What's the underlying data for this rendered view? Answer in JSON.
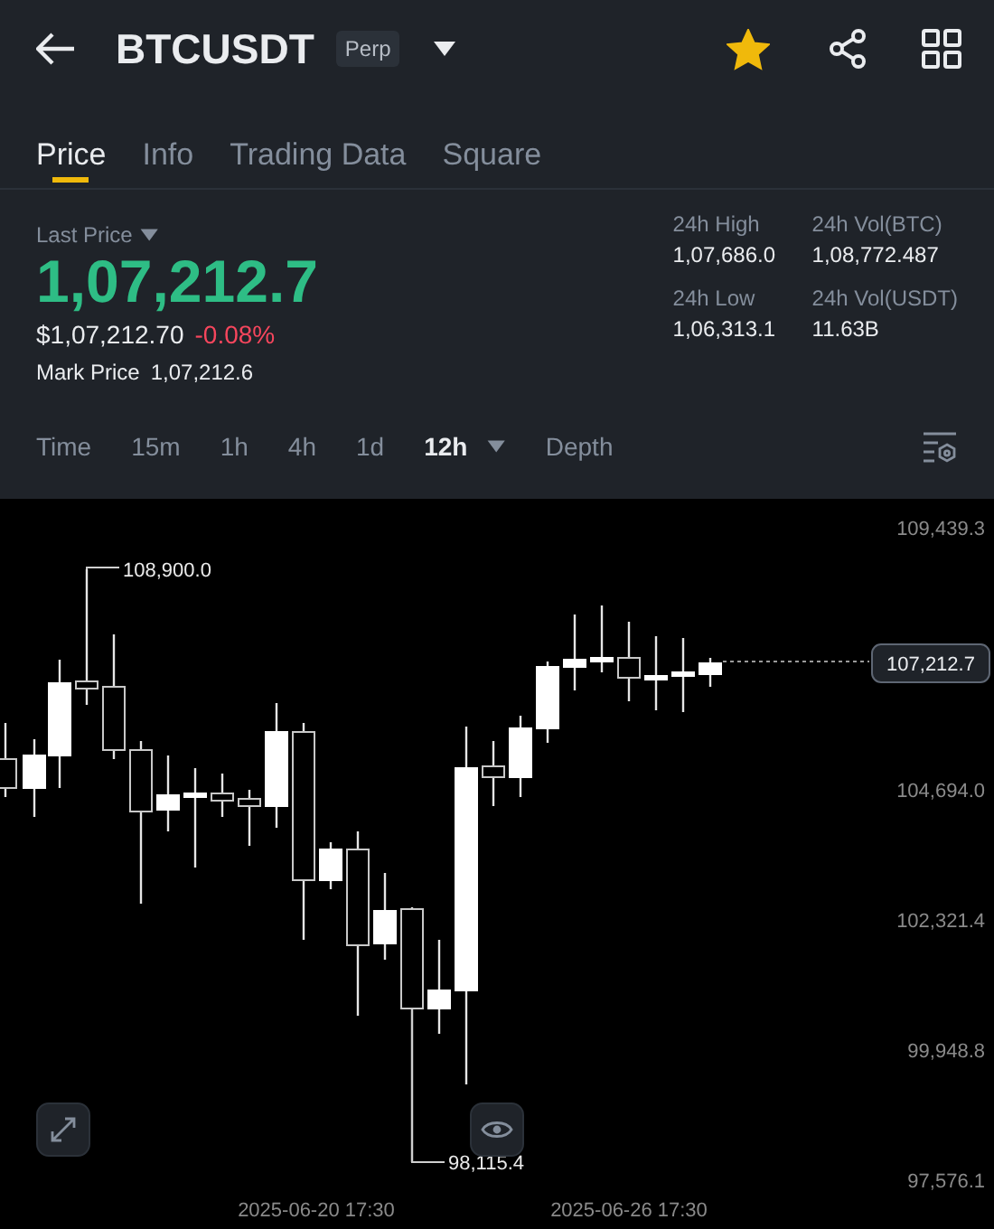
{
  "header": {
    "symbol": "BTCUSDT",
    "badge": "Perp",
    "favorite": true
  },
  "tabs": [
    {
      "label": "Price",
      "selected": true
    },
    {
      "label": "Info",
      "selected": false
    },
    {
      "label": "Trading Data",
      "selected": false
    },
    {
      "label": "Square",
      "selected": false
    }
  ],
  "price": {
    "label": "Last Price",
    "last": "1,07,212.7",
    "usd": "$1,07,212.70",
    "change": "-0.08%",
    "mark_label": "Mark Price",
    "mark": "1,07,212.6"
  },
  "stats": [
    {
      "label": "24h High",
      "value": "1,07,686.0"
    },
    {
      "label": "24h Vol(BTC)",
      "value": "1,08,772.487"
    },
    {
      "label": "24h Low",
      "value": "1,06,313.1"
    },
    {
      "label": "24h Vol(USDT)",
      "value": "11.63B"
    }
  ],
  "intervals": [
    {
      "label": "Time",
      "selected": false,
      "menu": false
    },
    {
      "label": "15m",
      "selected": false,
      "menu": false
    },
    {
      "label": "1h",
      "selected": false,
      "menu": false
    },
    {
      "label": "4h",
      "selected": false,
      "menu": false
    },
    {
      "label": "1d",
      "selected": false,
      "menu": false
    },
    {
      "label": "12h",
      "selected": true,
      "menu": true
    },
    {
      "label": "Depth",
      "selected": false,
      "menu": false
    }
  ],
  "chart": {
    "price_axis": [
      "109,439.3",
      "104,694.0",
      "102,321.4",
      "99,948.8",
      "97,576.1"
    ],
    "current_price": "107,212.7",
    "high_marker": "108,900.0",
    "low_marker": "98,115.4",
    "time_axis": [
      "2025-06-20 17:30",
      "2025-06-26 17:30"
    ]
  }
}
